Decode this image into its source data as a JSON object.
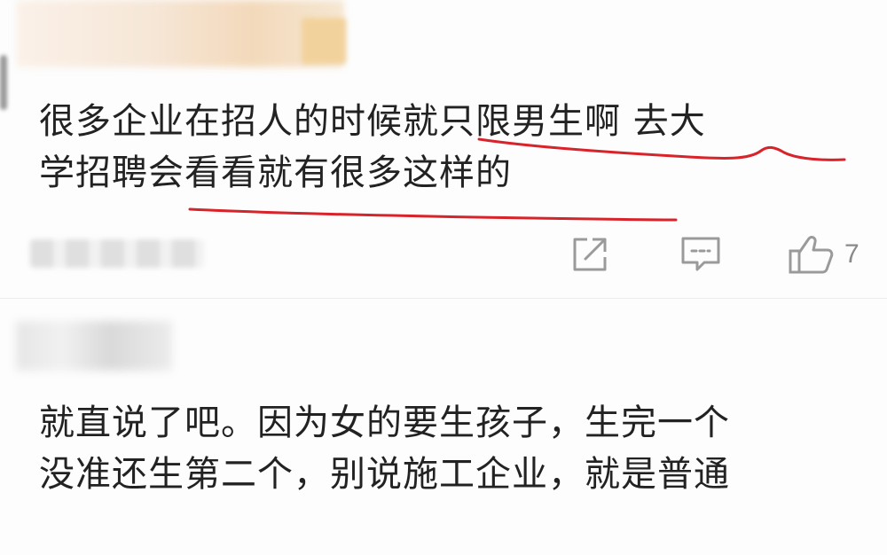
{
  "comments": [
    {
      "lines": [
        "很多企业在招人的时候就只限男生啊  去大",
        "学招聘会看看就有很多这样的"
      ],
      "like_count": "7"
    },
    {
      "lines": [
        "就直说了吧。因为女的要生孩子，生完一个",
        "没准还生第二个，别说施工企业，就是普通"
      ]
    }
  ],
  "icons": {
    "share": "share-icon",
    "reply": "comment-icon",
    "like": "thumbs-up-icon"
  },
  "colors": {
    "underline": "#d8232a",
    "icon": "#9a9a9a",
    "text": "#222222"
  }
}
